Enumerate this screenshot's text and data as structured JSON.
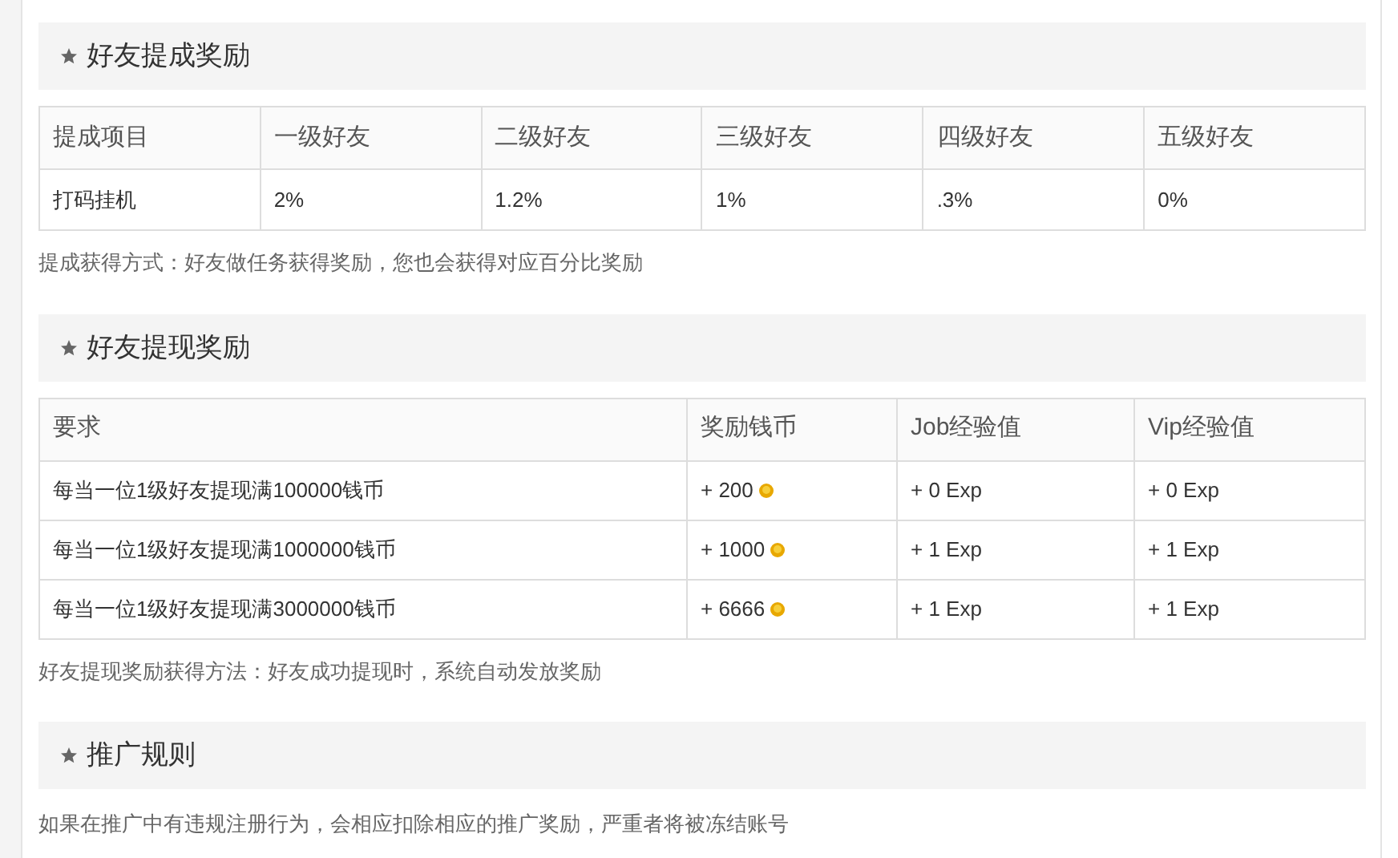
{
  "sections": [
    {
      "title": "好友提成奖励",
      "table": {
        "columns": [
          "提成项目",
          "一级好友",
          "二级好友",
          "三级好友",
          "四级好友",
          "五级好友"
        ],
        "rows": [
          [
            {
              "text": "打码挂机"
            },
            {
              "text": "2%"
            },
            {
              "text": "1.2%"
            },
            {
              "text": "1%"
            },
            {
              "text": ".3%"
            },
            {
              "text": "0%"
            }
          ]
        ]
      },
      "note": "提成获得方式：好友做任务获得奖励，您也会获得对应百分比奖励"
    },
    {
      "title": "好友提现奖励",
      "table": {
        "columns": [
          "要求",
          "奖励钱币",
          "Job经验值",
          "Vip经验值"
        ],
        "rows": [
          [
            {
              "text": "每当一位1级好友提现满100000钱币"
            },
            {
              "text": "+ 200",
              "coin": true
            },
            {
              "text": "+ 0 Exp"
            },
            {
              "text": "+ 0 Exp"
            }
          ],
          [
            {
              "text": "每当一位1级好友提现满1000000钱币"
            },
            {
              "text": "+ 1000",
              "coin": true
            },
            {
              "text": "+ 1 Exp"
            },
            {
              "text": "+ 1 Exp"
            }
          ],
          [
            {
              "text": "每当一位1级好友提现满3000000钱币"
            },
            {
              "text": "+ 6666",
              "coin": true
            },
            {
              "text": "+ 1 Exp"
            },
            {
              "text": "+ 1 Exp"
            }
          ]
        ]
      },
      "note": "好友提现奖励获得方法：好友成功提现时，系统自动发放奖励"
    },
    {
      "title": "推广规则",
      "note": "如果在推广中有违规注册行为，会相应扣除相应的推广奖励，严重者将被冻结账号"
    }
  ]
}
